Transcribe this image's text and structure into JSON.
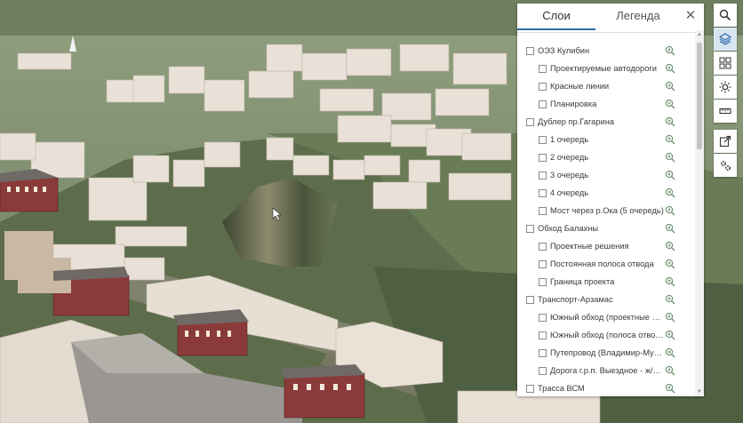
{
  "panel": {
    "tabs": [
      {
        "label": "Слои",
        "active": true
      },
      {
        "label": "Легенда",
        "active": false
      }
    ],
    "close_icon": "close-icon",
    "layers": [
      {
        "label": "ОЭЗ Кулибин",
        "level": 0,
        "checked": false
      },
      {
        "label": "Проектируемые автодороги",
        "level": 1,
        "checked": false
      },
      {
        "label": "Красные линии",
        "level": 1,
        "checked": false
      },
      {
        "label": "Планировка",
        "level": 1,
        "checked": false
      },
      {
        "label": "Дублер пр.Гагарина",
        "level": 0,
        "checked": false
      },
      {
        "label": "1 очередь",
        "level": 1,
        "checked": false
      },
      {
        "label": "2 очередь",
        "level": 1,
        "checked": false
      },
      {
        "label": "3 очередь",
        "level": 1,
        "checked": false
      },
      {
        "label": "4 очередь",
        "level": 1,
        "checked": false
      },
      {
        "label": "Мост через р.Ока (5 очередь)",
        "level": 1,
        "checked": false
      },
      {
        "label": "Обход Балахны",
        "level": 0,
        "checked": false
      },
      {
        "label": "Проектные решения",
        "level": 1,
        "checked": false
      },
      {
        "label": "Постоянная полоса отвода",
        "level": 1,
        "checked": false
      },
      {
        "label": "Граница проекта",
        "level": 1,
        "checked": false
      },
      {
        "label": "Транспорт-Арзамас",
        "level": 0,
        "checked": false
      },
      {
        "label": "Южный обход (проектные ре...",
        "level": 1,
        "checked": false
      },
      {
        "label": "Южный обход (полоса отвода)",
        "level": 1,
        "checked": false
      },
      {
        "label": "Путепровод (Владимир-Мур...",
        "level": 1,
        "checked": false
      },
      {
        "label": "Дорога г.р.п. Выездное - ж/д с...",
        "level": 1,
        "checked": false
      },
      {
        "label": "Трасса ВСМ",
        "level": 0,
        "checked": false
      }
    ]
  },
  "toolbar": {
    "tools": [
      {
        "icon": "search-icon",
        "active": false
      },
      {
        "icon": "layers-icon",
        "active": true
      },
      {
        "icon": "basemap-gallery-icon",
        "active": false
      },
      {
        "icon": "daylight-icon",
        "active": false
      },
      {
        "icon": "measure-icon",
        "active": false
      },
      {
        "icon": "share-icon",
        "active": false
      },
      {
        "icon": "settings-icon",
        "active": false
      }
    ]
  },
  "colors": {
    "accent": "#2e6ea6",
    "building": "#e8e0d6",
    "terrain": "#5f6f4f",
    "sky": "#8a9a7c"
  }
}
